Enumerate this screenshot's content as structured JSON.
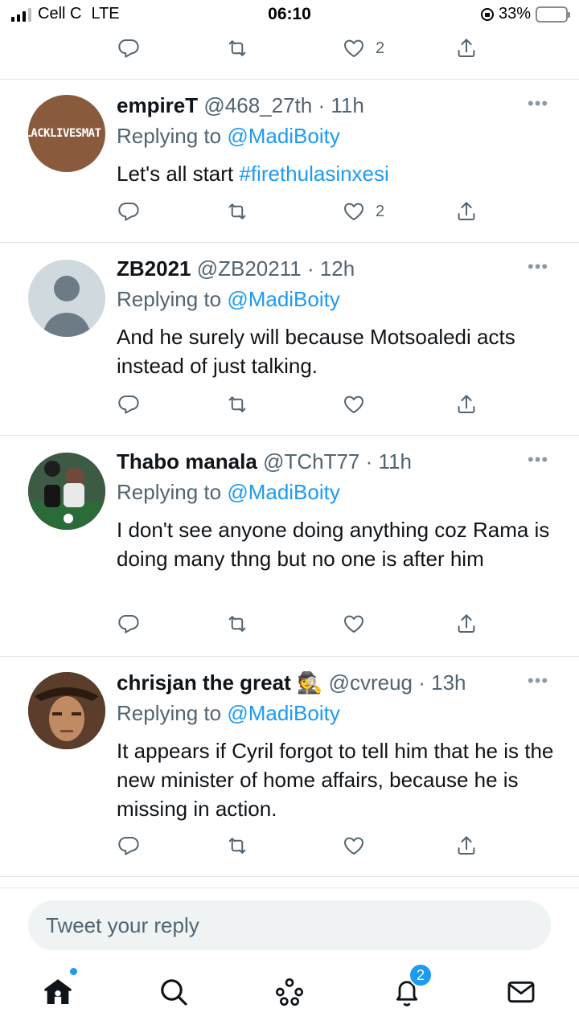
{
  "status_bar": {
    "carrier": "Cell C",
    "network": "LTE",
    "time": "06:10",
    "battery_percent": "33%",
    "battery_level": 0.33,
    "battery_color": "#f5c400"
  },
  "top_actions": {
    "like_count": "2"
  },
  "tweets": [
    {
      "name": "empireT",
      "handle": "@468_27th",
      "time": "11h",
      "replying_prefix": "Replying to ",
      "replying_to": "@MadiBoity",
      "body_prefix": "Let's all start ",
      "body_hashtag": "#firethulasinxesi",
      "like_count": "2",
      "avatar_text": "BLACKLIVESMAT"
    },
    {
      "name": "ZB2021",
      "handle": "@ZB20211",
      "time": "12h",
      "replying_prefix": "Replying to ",
      "replying_to": "@MadiBoity",
      "body": "And he surely will because Motsoaledi acts instead of just talking."
    },
    {
      "name": "Thabo manala",
      "handle": "@TChT77",
      "time": "11h",
      "replying_prefix": "Replying to ",
      "replying_to": "@MadiBoity",
      "body": "I don't see anyone doing anything coz Rama is doing many thng but no one is after him"
    },
    {
      "name": "chrisjan the great",
      "name_emoji": "🕵️",
      "handle": "@cvreug",
      "time": "13h",
      "replying_prefix": "Replying to ",
      "replying_to": "@MadiBoity",
      "body": "It appears if Cyril forgot to tell him that he is the new minister of home affairs, because he is missing in action."
    }
  ],
  "reply_box": {
    "placeholder": "Tweet your reply"
  },
  "nav": {
    "items": [
      "home-icon",
      "search-icon",
      "spaces-icon",
      "notifications-icon",
      "messages-icon"
    ],
    "notification_badge": "2"
  },
  "colors": {
    "accent": "#1d9bf0",
    "secondary_text": "#536471",
    "divider": "#e1e6ea"
  }
}
